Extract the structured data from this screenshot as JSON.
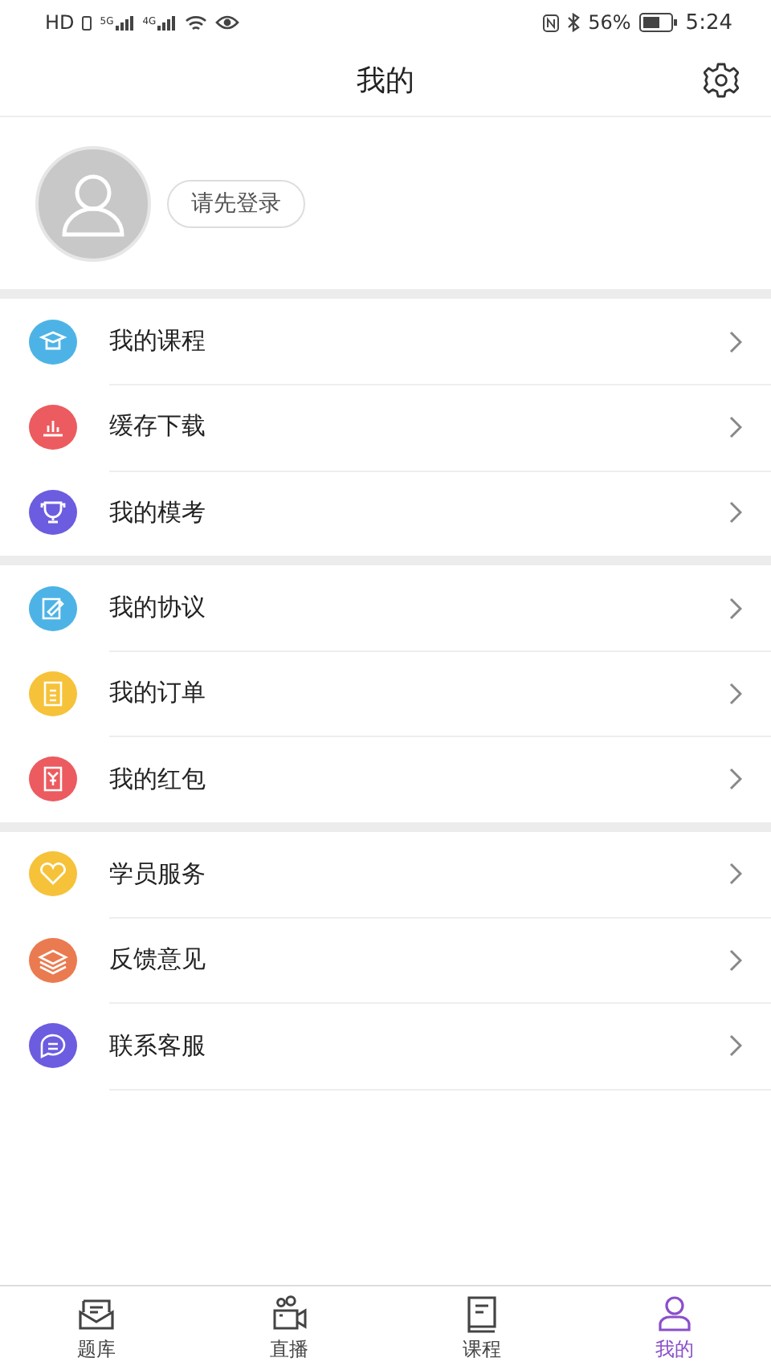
{
  "status_bar": {
    "hd": "HD",
    "signals": [
      "5G",
      "4G"
    ],
    "battery_text": "56%",
    "time": "5:24"
  },
  "header": {
    "title": "我的"
  },
  "profile": {
    "login_button": "请先登录"
  },
  "menu_groups": [
    {
      "items": [
        {
          "label": "我的课程",
          "color": "#4db3e6"
        },
        {
          "label": "缓存下载",
          "color": "#ec5b5f"
        },
        {
          "label": "我的模考",
          "color": "#6c5ce0"
        }
      ]
    },
    {
      "items": [
        {
          "label": "我的协议",
          "color": "#4db3e6"
        },
        {
          "label": "我的订单",
          "color": "#f6c239"
        },
        {
          "label": "我的红包",
          "color": "#ec5b5f"
        }
      ]
    },
    {
      "items": [
        {
          "label": "学员服务",
          "color": "#f6c239"
        },
        {
          "label": "反馈意见",
          "color": "#ea7b50"
        },
        {
          "label": "联系客服",
          "color": "#6c5ce0"
        }
      ]
    }
  ],
  "tab_bar": [
    {
      "label": "题库",
      "selected": false
    },
    {
      "label": "直播",
      "selected": false
    },
    {
      "label": "课程",
      "selected": false
    },
    {
      "label": "我的",
      "selected": true
    }
  ]
}
